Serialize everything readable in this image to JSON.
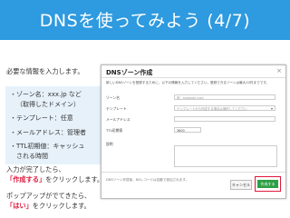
{
  "slide": {
    "title": "DNSを使ってみよう (4/7)",
    "intro": "必要な情報を入力します。",
    "bullets": [
      {
        "lines": [
          "・ゾーン名：xxx.jp など",
          "（取得したドメイン）"
        ]
      },
      {
        "lines": [
          "・テンプレート：任意"
        ]
      },
      {
        "lines": [
          "・メールアドレス：管理者"
        ]
      },
      {
        "lines": [
          "・TTL初期値：キャッシュ",
          "される時間"
        ]
      }
    ],
    "instructions": {
      "line1": "入力が完了したら、",
      "line2_red": "「作成する」",
      "line2_rest": "をクリックします。",
      "line3": "ポップアップがでてきたら、",
      "line4_red": "「はい」",
      "line4_rest": "をクリックします。"
    }
  },
  "dialog": {
    "title": "DNSゾーン作成",
    "close": "×",
    "description": "新しいDNSゾーンを登録するために、以下の情報を入力してください。登録できるゾーンは最大10件までです。",
    "fields": {
      "zone": {
        "label": "ゾーン名",
        "placeholder": "例：example.com"
      },
      "template": {
        "label": "テンプレート",
        "value": "テンプレートから作成する場合は選択してください"
      },
      "email": {
        "label": "メールアドレス",
        "value": ""
      },
      "ttl": {
        "label": "TTL初期値",
        "value": "3600"
      },
      "memo": {
        "label": "説明",
        "value": ""
      }
    },
    "footer_note": "DNSゾーン作成後、NSレコードは自動で追加されます。",
    "cancel_label": "キャンセル",
    "create_label": "作成する"
  }
}
